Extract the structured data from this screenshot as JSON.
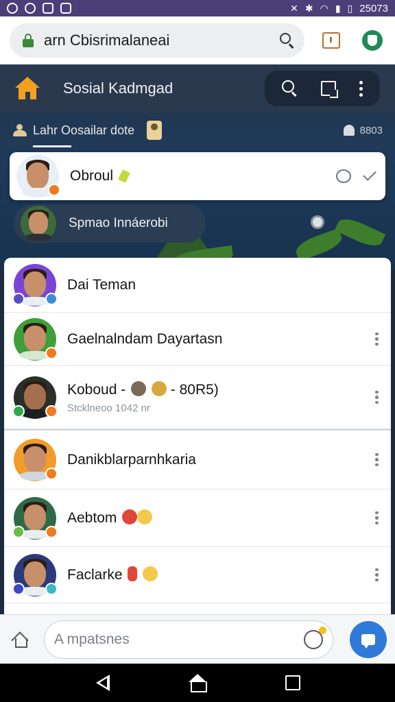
{
  "status_bar": {
    "time": "25073"
  },
  "browser": {
    "url": "arn Cbisrimalaneai"
  },
  "app_header": {
    "title": "Sosial Kadmgad"
  },
  "sub_nav": {
    "active_tab": "Lahr Oosailar dote",
    "right_count": "8803"
  },
  "pinned_chat": {
    "name": "Obroul"
  },
  "suggestion": {
    "label": "Spmao Innáerobi"
  },
  "chats": [
    {
      "name": "Dai Teman",
      "subtitle": "",
      "avatar_bg": "#7a45d6",
      "badge_left": "#5a4fc2",
      "badge_right": "#3f8ad8"
    },
    {
      "name": "Gaelnalndam Dayartasn",
      "subtitle": "",
      "avatar_bg": "#3fa03a",
      "badge_left": "",
      "badge_right": "#f07a1c"
    },
    {
      "name": "Koboud -",
      "name_suffix": "- 80R5)",
      "subtitle": "Stcklneoo 1042 nr",
      "avatar_bg": "#2a2f2a",
      "badge_left": "#2fa84c",
      "badge_right": "#f07a1c"
    },
    {
      "name": "Danikblarparnhkaria",
      "subtitle": "",
      "avatar_bg": "#f29a2a",
      "badge_left": "",
      "badge_right": "#f07a1c"
    },
    {
      "name": "Aebtom",
      "subtitle": "",
      "avatar_bg": "#2f6a46",
      "badge_left": "#6bbd4a",
      "badge_right": "#f07a1c"
    },
    {
      "name": "Faclarke",
      "subtitle": "",
      "avatar_bg": "#2b3a7a",
      "badge_left": "#3a47c9",
      "badge_right": "#39b8c9"
    }
  ],
  "composer": {
    "placeholder": "A mpatsnes"
  },
  "colors": {
    "status_bar": "#4a3f78",
    "app_header": "#2a394d",
    "accent_orange": "#f2a022",
    "send_blue": "#2f7ad9"
  },
  "icons": {
    "header_home": "home-icon",
    "search": "search-icon",
    "compose": "compose-icon",
    "menu": "kebab-icon",
    "send": "chat-bubble-icon"
  }
}
